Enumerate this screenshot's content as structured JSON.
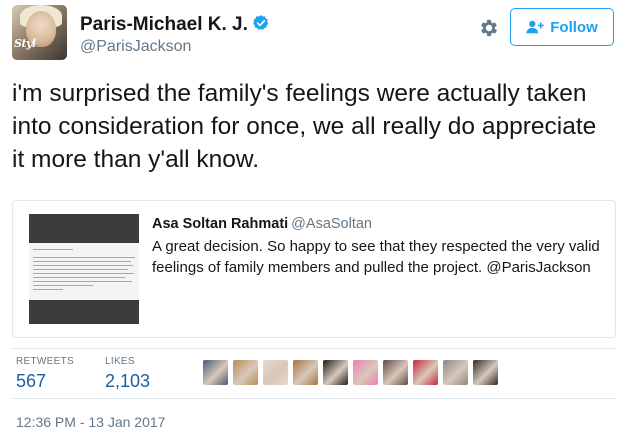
{
  "author": {
    "name": "Paris-Michael K. J.",
    "handle": "@ParisJackson",
    "avatar_wordmark": "Styl"
  },
  "actions": {
    "settings_icon": "gear-icon",
    "follow_label": "Follow",
    "follow_icon": "add-user-icon"
  },
  "tweet": {
    "text": "i'm surprised the family's feelings were actually taken into consideration for once, we all really do appreciate it more than y'all know."
  },
  "quoted_tweet": {
    "name": "Asa Soltan Rahmati",
    "handle": "@AsaSoltan",
    "text": "A great decision. So happy to see that they respected the very valid feelings of family members and pulled the project. @ParisJackson"
  },
  "stats": {
    "retweets_label": "RETWEETS",
    "retweets_value": "567",
    "likes_label": "LIKES",
    "likes_value": "2,103"
  },
  "likers": [
    {
      "color": "#4a5b7a"
    },
    {
      "color": "#b88c5a"
    },
    {
      "color": "#e7d6cf"
    },
    {
      "color": "#a77445"
    },
    {
      "color": "#1f1f1f"
    },
    {
      "color": "#ef7fb4"
    },
    {
      "color": "#5e4a4a"
    },
    {
      "color": "#c6283d"
    },
    {
      "color": "#8a8a8a"
    },
    {
      "color": "#2c2c2c"
    }
  ],
  "timestamp": "12:36 PM - 13 Jan 2017",
  "colors": {
    "accent": "#1da1f2",
    "stat_value": "#1b5e9c",
    "secondary_text": "#657786",
    "border": "#e1e8ed"
  }
}
